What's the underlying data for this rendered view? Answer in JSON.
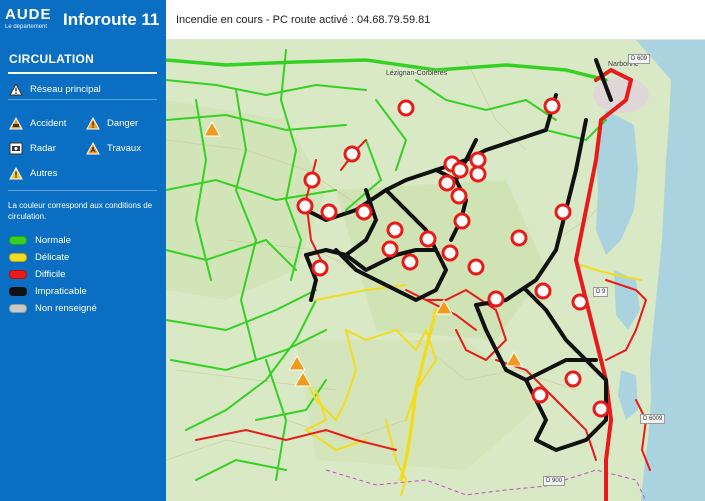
{
  "brand": {
    "logo": "AUDE",
    "logo_sub": "Le département",
    "title": "Inforoute 11"
  },
  "banner": {
    "text": "Incendie en cours - PC route activé : 04.68.79.59.81"
  },
  "sidebar": {
    "title": "CIRCULATION",
    "network_label": "Réseau principal",
    "events": [
      {
        "icon": "accident-icon",
        "label": "Accident"
      },
      {
        "icon": "danger-icon",
        "label": "Danger"
      },
      {
        "icon": "radar-icon",
        "label": "Radar"
      },
      {
        "icon": "roadworks-icon",
        "label": "Travaux"
      },
      {
        "icon": "other-icon",
        "label": "Autres"
      }
    ],
    "note": "La couleur correspond aux conditions de circulation.",
    "legend": [
      {
        "label": "Normale",
        "color": "#35d023"
      },
      {
        "label": "Délicate",
        "color": "#f2dc22"
      },
      {
        "label": "Difficile",
        "color": "#e81a1a"
      },
      {
        "label": "Impraticable",
        "color": "#111111"
      },
      {
        "label": "Non renseigné",
        "color": "#c9c9c9"
      }
    ]
  },
  "map": {
    "places": [
      "Narbonne",
      "Lézignan-Corbières"
    ],
    "road_refs": [
      "D 609",
      "D 900",
      "D 9",
      "D 6009"
    ],
    "colors": {
      "normal": "#35d023",
      "delicate": "#f2dc22",
      "difficult": "#e81a1a",
      "impassable": "#111111",
      "sea": "#aad3df",
      "land": "#d9e9c6"
    }
  }
}
